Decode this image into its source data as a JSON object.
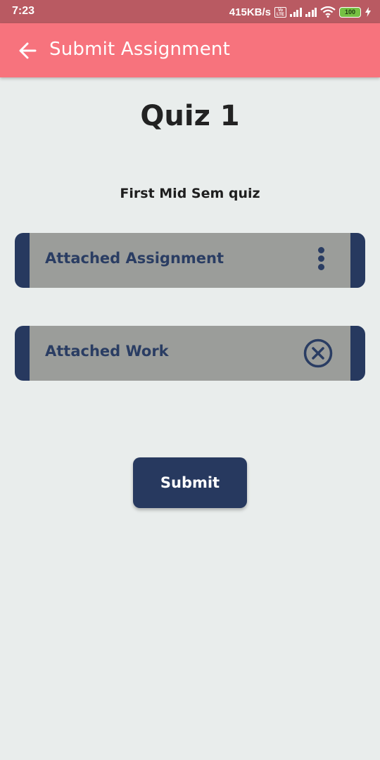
{
  "status_bar": {
    "time": "7:23",
    "speed": "415KB/s",
    "volte": "Vo LTE",
    "battery": "100"
  },
  "app_bar": {
    "title": "Submit Assignment",
    "back_icon": "arrow-left-icon"
  },
  "quiz": {
    "title": "Quiz 1",
    "description": "First Mid Sem quiz"
  },
  "cards": {
    "attached_assignment": {
      "label": "Attached Assignment",
      "icon": "more-vert-icon"
    },
    "attached_work": {
      "label": "Attached Work",
      "icon": "cancel-circle-icon"
    }
  },
  "actions": {
    "submit_label": "Submit"
  },
  "colors": {
    "status_bar": "#b95a62",
    "app_bar": "#f7737d",
    "background": "#e9edec",
    "accent_navy": "#27395f",
    "card_fill": "#9b9d9a"
  }
}
